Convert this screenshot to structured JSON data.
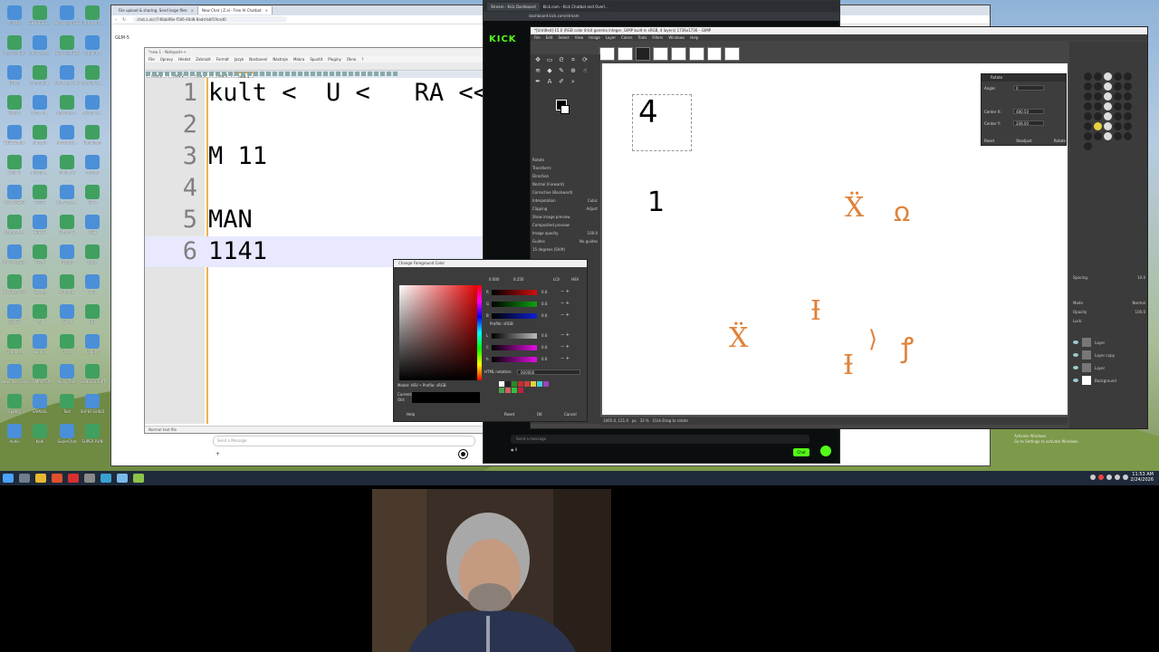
{
  "taskbar": {
    "time": "11:53 AM",
    "date": "2/24/2026"
  },
  "desktop_icons": [
    "This PC",
    "SHARE KS...",
    "Nový Text Dokument",
    "ultime shi...",
    "Recycle Bin",
    "nova_text...",
    "Nový Text Dokume...",
    "vampire...",
    "Brave",
    "chamobj...",
    "novy_text_jako...",
    "prekladac...",
    "Firefox",
    "blcov_d...",
    "novy text...",
    "neimg_d...",
    "OBS Studio",
    "obrazky",
    "novyTekst...",
    "Bandicam",
    "GIMP 3",
    "pdfsplit...",
    "blank.txt",
    "novy.py",
    "DOCUMENT",
    "STATS",
    "Novy text...",
    "GIFs",
    "Notepad++",
    "SPECS",
    "Python 3",
    "RGB",
    "New Text Docume...",
    "Excel",
    "Python",
    "Code",
    "New Text Docume...",
    "Screen",
    "Python1",
    "Tool",
    "SUPER",
    "AI",
    "Word",
    "PDF",
    "Update",
    "Sonic",
    "Text",
    "Logger",
    "New Text Document",
    "COMPUTER",
    "Novy Text",
    "SUPER SCRIPT",
    "Spotify",
    "SAMUEL",
    "Text",
    "SUPER BUILD",
    "Audio",
    "Kodi",
    "SuperChat",
    "SUPER RUN"
  ],
  "browser": {
    "tabs": [
      {
        "label": "File upload & sharing. Send large files",
        "close": "×"
      },
      {
        "label": "New Chat | Z.ai - Free AI Chatbot",
        "close": "×"
      }
    ],
    "address": "chat.z.ai/c/748ab98e-f566-46d8-8add-bbf19cad0",
    "model": "GLM-5",
    "chat_placeholder": "Send a Message",
    "plus": "+"
  },
  "notepad": {
    "title": "*new 1 - Notepad++",
    "menu": [
      "File",
      "Úpravy",
      "Hledat",
      "Zobrazit",
      "Formát",
      "Jazyk",
      "Nastavení",
      "Nástroje",
      "Makra",
      "Spustit",
      "Pluginy",
      "Okno",
      "?"
    ],
    "tabs": [
      "new 1",
      "new 2",
      "new 3",
      "new 4",
      "new 5"
    ],
    "lines": [
      {
        "num": "1",
        "text": "kult <  U <   RA <<<"
      },
      {
        "num": "2",
        "text": ""
      },
      {
        "num": "3",
        "text": "M 11"
      },
      {
        "num": "4",
        "text": ""
      },
      {
        "num": "5",
        "text": "MAN"
      },
      {
        "num": "6",
        "text": "1141"
      }
    ],
    "status": "Normal text file"
  },
  "kick": {
    "tabs": [
      "Stream - Kick Dashboard",
      "Kick.com - Kick Chatbot and Overl..."
    ],
    "address": "dashboard.kick.com/stream",
    "logo": "KICK",
    "message_placeholder": "Send a message",
    "chat_button": "Chat",
    "viewers": "0"
  },
  "gimp": {
    "title": "*[Untitled]-15.0 (RGB color 8-bit gamma integer, GIMP built-in sRGB, 4 layers) 1736x1736 – GIMP",
    "menu": [
      "File",
      "Edit",
      "Select",
      "View",
      "Image",
      "Layer",
      "Colors",
      "Tools",
      "Filters",
      "Windows",
      "Help"
    ],
    "tool_options": {
      "section": "Rotate",
      "transform": "Transform:",
      "direction": "Direction",
      "normal": "Normal (Forward)",
      "corrective": "Corrective (Backward)",
      "interpolation": "Interpolation",
      "interp_value": "Cubic",
      "clipping": "Clipping",
      "clip_value": "Adjust",
      "show_preview": "Show image preview",
      "composited": "Composited preview",
      "opacity": "Image opacity",
      "opacity_value": "100.0",
      "guides": "Guides",
      "guides_value": "No guides",
      "constraint": "15 degrees (Shift)"
    },
    "canvas": {
      "digit_four": "4",
      "digit_one": "1",
      "glyphs": [
        "Ẍ",
        "ꭥ",
        "Ɨ",
        "Ẍ",
        "Ɨ",
        "Ɨ",
        "⟩",
        "ꝭ"
      ]
    },
    "status": {
      "coords": "1065.0, 121.0",
      "unit": "px",
      "zoom": "33 %",
      "hint": "Click-Drag to rotate"
    },
    "rotate_dialog": {
      "title": "Rotate",
      "angle_label": "Angle:",
      "angle_value": "0",
      "center_x_label": "Center X:",
      "center_x_value": "480.50",
      "center_y_label": "Center Y:",
      "center_y_value": "208.00",
      "reset": "Reset",
      "readjust": "Readjust",
      "rotate": "Rotate"
    },
    "layers": {
      "mode_label": "Mode",
      "mode_value": "Normal",
      "opacity_label": "Opacity",
      "opacity_value": "100.0",
      "lock_label": "Lock:",
      "spacing_label": "Spacing",
      "spacing_value": "10.0",
      "items": [
        "Layer",
        "Layer copy",
        "Layer",
        "Background"
      ]
    }
  },
  "color_dialog": {
    "title": "Change Foreground Color",
    "hsv_readout": "0.000",
    "hsv_readout2": "0.250",
    "lch_tab": "LCh",
    "hsv_tab": "HSV",
    "profile_label": "Profile: sRGB",
    "model_label": "Model: HSV • Profile: sRGB",
    "channels": [
      {
        "name": "R",
        "value": "0.0",
        "color": "#d01010"
      },
      {
        "name": "G",
        "value": "0.0",
        "color": "#10a010"
      },
      {
        "name": "B",
        "value": "0.0",
        "color": "#1020d0"
      },
      {
        "name": "L",
        "value": "0.0",
        "color": "#bbbbbb"
      },
      {
        "name": "C",
        "value": "0.0",
        "color": "#e010e0"
      },
      {
        "name": "h",
        "value": "0.0",
        "color": "#e010e0"
      }
    ],
    "html_label": "HTML notation:",
    "hex": "000000",
    "current_label": "Current:",
    "old_label": "Old:",
    "buttons": {
      "help": "Help",
      "reset": "Reset",
      "ok": "OK",
      "cancel": "Cancel"
    }
  },
  "activation": {
    "line1": "Activate Windows",
    "line2": "Go to Settings to activate Windows."
  }
}
